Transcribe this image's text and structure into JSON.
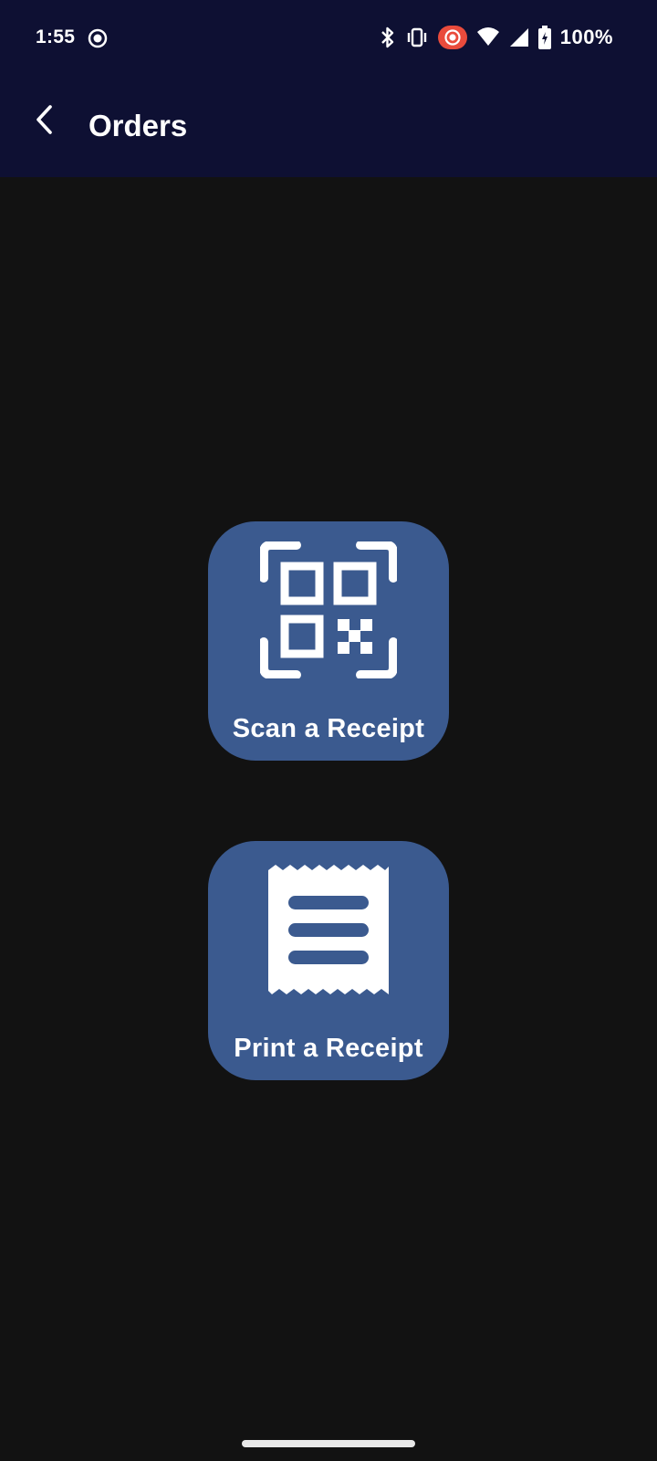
{
  "status_bar": {
    "time": "1:55",
    "battery": "100%",
    "icons": [
      "screen-record-icon",
      "bluetooth-icon",
      "vibrate-icon",
      "recording-indicator-icon",
      "wifi-icon",
      "cell-signal-icon",
      "battery-icon"
    ]
  },
  "app_bar": {
    "title": "Orders",
    "back_icon": "chevron-left-icon"
  },
  "actions": {
    "scan": {
      "label": "Scan a Receipt",
      "icon": "qr-code-scan-icon"
    },
    "print": {
      "label": "Print a Receipt",
      "icon": "receipt-icon"
    }
  },
  "colors": {
    "top_bar": "#0e1033",
    "background": "#121212",
    "tile": "#3b5a8f",
    "recording_red": "#e94b3c"
  }
}
